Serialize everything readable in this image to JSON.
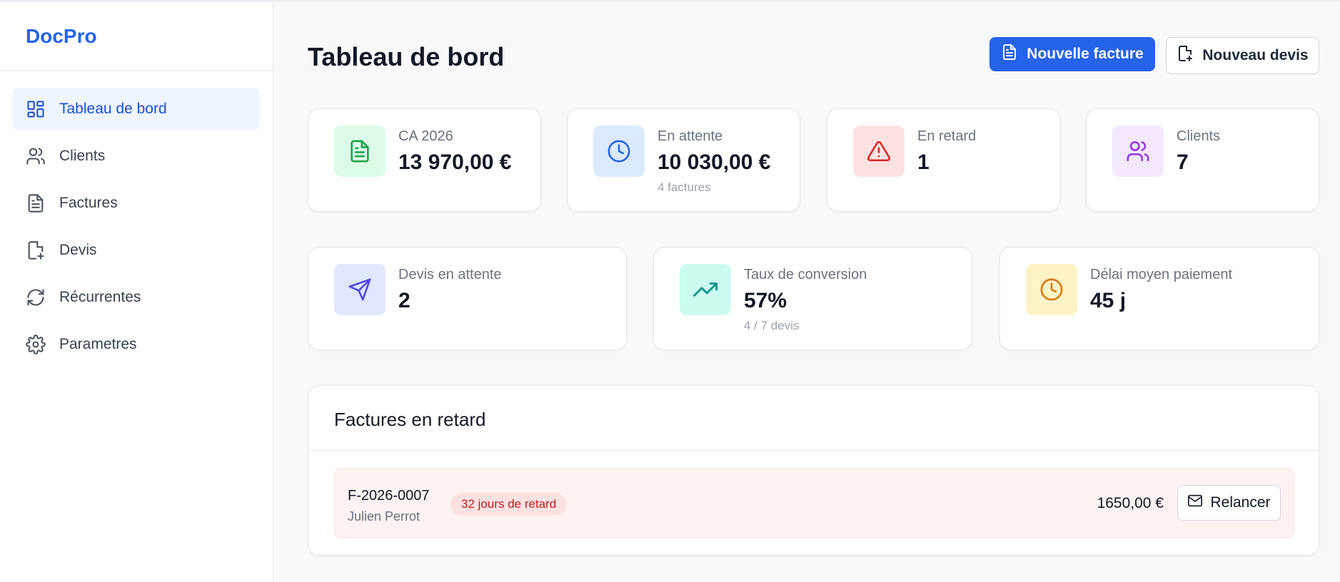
{
  "app": {
    "brand": "DocPro"
  },
  "sidebar": {
    "items": [
      {
        "label": "Tableau de bord",
        "icon": "dashboard-icon",
        "active": true
      },
      {
        "label": "Clients",
        "icon": "users-icon"
      },
      {
        "label": "Factures",
        "icon": "file-text-icon"
      },
      {
        "label": "Devis",
        "icon": "file-plus-icon"
      },
      {
        "label": "Récurrentes",
        "icon": "refresh-icon"
      },
      {
        "label": "Parametres",
        "icon": "gear-icon"
      }
    ]
  },
  "header": {
    "title": "Tableau de bord",
    "primary_button": "Nouvelle facture",
    "secondary_button": "Nouveau devis"
  },
  "stats_row1": [
    {
      "label": "CA 2026",
      "value": "13 970,00 €",
      "sub": "",
      "icon": "file-text-icon",
      "bg": "#dcfce7",
      "color": "#16a34a"
    },
    {
      "label": "En attente",
      "value": "10 030,00 €",
      "sub": "4 factures",
      "icon": "clock-icon",
      "bg": "#dbeafe",
      "color": "#2563eb"
    },
    {
      "label": "En retard",
      "value": "1",
      "sub": "",
      "icon": "alert-triangle-icon",
      "bg": "#fee2e2",
      "color": "#dc2626"
    },
    {
      "label": "Clients",
      "value": "7",
      "sub": "",
      "icon": "users-icon",
      "bg": "#f3e8ff",
      "color": "#9333ea"
    }
  ],
  "stats_row2": [
    {
      "label": "Devis en attente",
      "value": "2",
      "sub": "",
      "icon": "send-icon",
      "bg": "#e0e7ff",
      "color": "#4f46e5"
    },
    {
      "label": "Taux de conversion",
      "value": "57%",
      "sub": "4 / 7 devis",
      "icon": "trending-up-icon",
      "bg": "#ccfbf1",
      "color": "#0d9488"
    },
    {
      "label": "Délai moyen paiement",
      "value": "45 j",
      "sub": "",
      "icon": "clock-icon",
      "bg": "#fef3c7",
      "color": "#d97706"
    }
  ],
  "overdue": {
    "title": "Factures en retard",
    "rows": [
      {
        "number": "F-2026-0007",
        "client": "Julien Perrot",
        "badge": "32 jours de retard",
        "amount": "1650,00 €",
        "action": "Relancer"
      }
    ]
  }
}
